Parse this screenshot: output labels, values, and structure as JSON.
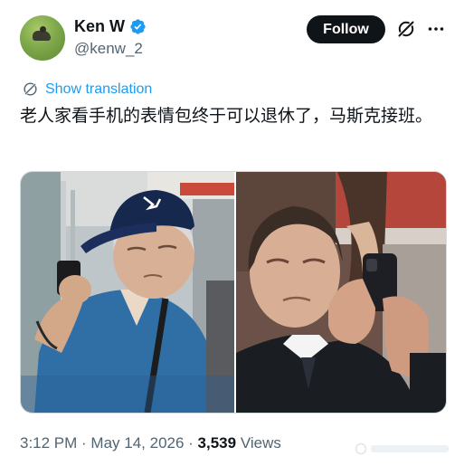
{
  "author": {
    "name": "Ken W",
    "handle": "@kenw_2",
    "avatar_icon": "avatar-image",
    "verified_icon": "verified-badge-icon",
    "verified_color": "#1d9bf0"
  },
  "header": {
    "follow_label": "Follow",
    "grok_icon": "grok-icon",
    "more_icon": "more-options-icon"
  },
  "translation": {
    "label": "Show translation",
    "icon": "globe-translate-icon",
    "color": "#1d9bf0"
  },
  "tweet": {
    "text": "老人家看手机的表情包终于可以退休了，马斯克接班。"
  },
  "media": {
    "left_image": "photo-old-man-squinting-at-phone",
    "right_image": "photo-man-squinting-at-phone"
  },
  "meta": {
    "time": "3:12 PM",
    "separator1": " · ",
    "date": "May 14, 2026",
    "separator2": " · ",
    "views_count": "3,539",
    "views_label": " Views"
  }
}
